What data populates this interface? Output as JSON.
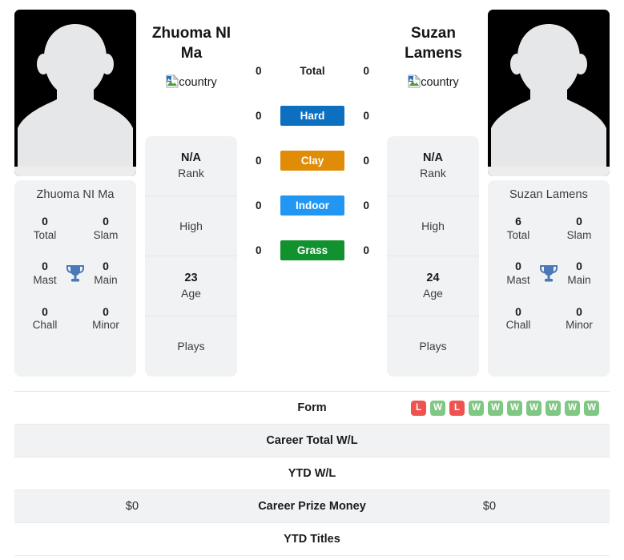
{
  "players": {
    "left": {
      "heading": "Zhuoma NI Ma",
      "card_name": "Zhuoma NI Ma",
      "country_alt": "country",
      "rank_value": "N/A",
      "rank_label": "Rank",
      "high_value": "",
      "high_label": "High",
      "age_value": "23",
      "age_label": "Age",
      "plays_value": "",
      "plays_label": "Plays",
      "titles": {
        "total_value": "0",
        "total_label": "Total",
        "slam_value": "0",
        "slam_label": "Slam",
        "mast_value": "0",
        "mast_label": "Mast",
        "main_value": "0",
        "main_label": "Main",
        "chall_value": "0",
        "chall_label": "Chall",
        "minor_value": "0",
        "minor_label": "Minor"
      }
    },
    "right": {
      "heading": "Suzan Lamens",
      "card_name": "Suzan Lamens",
      "country_alt": "country",
      "rank_value": "N/A",
      "rank_label": "Rank",
      "high_value": "",
      "high_label": "High",
      "age_value": "24",
      "age_label": "Age",
      "plays_value": "",
      "plays_label": "Plays",
      "titles": {
        "total_value": "6",
        "total_label": "Total",
        "slam_value": "0",
        "slam_label": "Slam",
        "mast_value": "0",
        "mast_label": "Mast",
        "main_value": "0",
        "main_label": "Main",
        "chall_value": "0",
        "chall_label": "Chall",
        "minor_value": "0",
        "minor_label": "Minor"
      }
    }
  },
  "surfaces": [
    {
      "label": "Total",
      "left": "0",
      "right": "0",
      "color": "transparent",
      "plain": true
    },
    {
      "label": "Hard",
      "left": "0",
      "right": "0",
      "color": "#0c6fc0",
      "plain": false
    },
    {
      "label": "Clay",
      "left": "0",
      "right": "0",
      "color": "#e08c07",
      "plain": false
    },
    {
      "label": "Indoor",
      "left": "0",
      "right": "0",
      "color": "#2196f3",
      "plain": false
    },
    {
      "label": "Grass",
      "left": "0",
      "right": "0",
      "color": "#11922f",
      "plain": false
    }
  ],
  "comparison_rows": [
    {
      "label": "Form",
      "left": "",
      "right": "",
      "shaded": false,
      "badges": [
        "L",
        "W",
        "L",
        "W",
        "W",
        "W",
        "W",
        "W",
        "W",
        "W"
      ]
    },
    {
      "label": "Career Total W/L",
      "left": "",
      "right": "",
      "shaded": true,
      "badges": []
    },
    {
      "label": "YTD W/L",
      "left": "",
      "right": "",
      "shaded": false,
      "badges": []
    },
    {
      "label": "Career Prize Money",
      "left": "$0",
      "right": "$0",
      "shaded": true,
      "badges": []
    },
    {
      "label": "YTD Titles",
      "left": "",
      "right": "",
      "shaded": false,
      "badges": []
    }
  ],
  "colors": {
    "hard": "#0c6fc0",
    "clay": "#e08c07",
    "indoor": "#2196f3",
    "grass": "#11922f",
    "win_badge": "#81c784",
    "loss_badge": "#ef5350",
    "trophy": "#4a7ab5",
    "card_bg": "#f1f2f3"
  },
  "icons": {
    "avatar": "player-silhouette-icon",
    "trophy": "trophy-icon",
    "broken_image": "broken-image-icon"
  }
}
